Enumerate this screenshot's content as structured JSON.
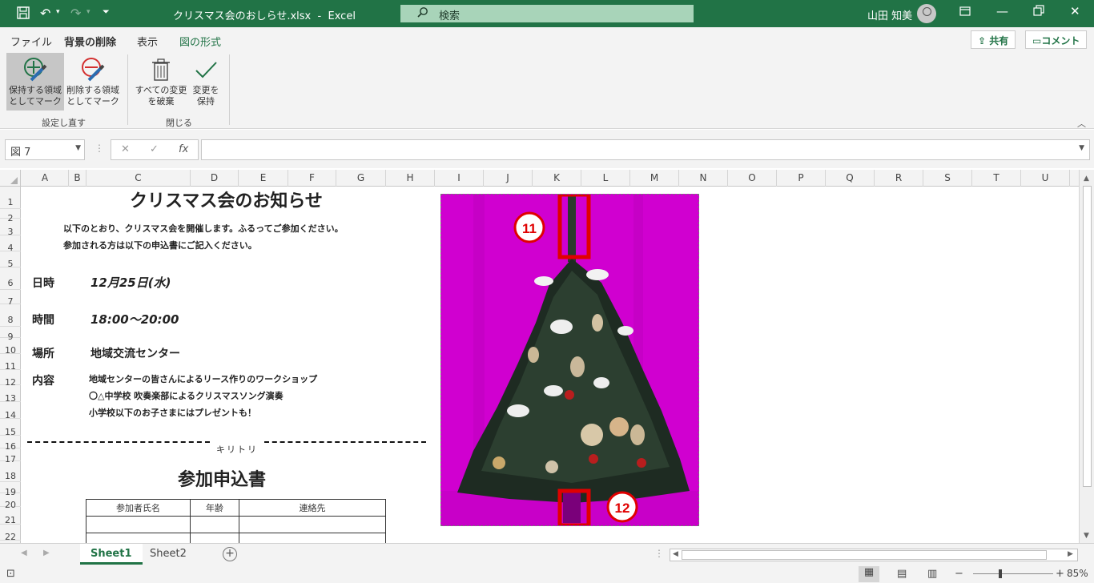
{
  "window": {
    "filename": "クリスマス会のおしらせ.xlsx",
    "separator": "-",
    "app": "Excel",
    "search_placeholder": "検索",
    "user_name": "山田 知美"
  },
  "ribbon": {
    "tabs": [
      "ファイル",
      "背景の削除",
      "表示",
      "図の形式"
    ],
    "share_label": "共有",
    "comment_label": "コメント",
    "buttons": {
      "mark_keep_l1": "保持する領域",
      "mark_keep_l2": "としてマーク",
      "mark_remove_l1": "削除する領域",
      "mark_remove_l2": "としてマーク",
      "discard_l1": "すべての変更",
      "discard_l2": "を破棄",
      "keep_l1": "変更を",
      "keep_l2": "保持"
    },
    "groups": {
      "refine": "設定し直す",
      "close": "閉じる"
    }
  },
  "formula_bar": {
    "name_box": "図 7",
    "fx": "fx",
    "value": ""
  },
  "columns": [
    "A",
    "B",
    "C",
    "D",
    "E",
    "F",
    "G",
    "H",
    "I",
    "J",
    "K",
    "L",
    "M",
    "N",
    "O",
    "P",
    "Q",
    "R",
    "S",
    "T",
    "U"
  ],
  "rows": [
    "1",
    "2",
    "3",
    "4",
    "5",
    "6",
    "7",
    "8",
    "9",
    "10",
    "11",
    "12",
    "13",
    "14",
    "15",
    "16",
    "17",
    "18",
    "19",
    "20",
    "21",
    "22"
  ],
  "document": {
    "title": "クリスマス会のお知らせ",
    "intro_1": "以下のとおり、クリスマス会を開催します。ふるってご参加ください。",
    "intro_2": "参加される方は以下の申込書にご記入ください。",
    "date_label": "日時",
    "date_value": "12月25日(水)",
    "time_label": "時間",
    "time_value": "18:00～20:00",
    "place_label": "場所",
    "place_value": "地域交流センター",
    "content_label": "内容",
    "content_1": "地域センターの皆さんによるリース作りのワークショップ",
    "content_2": "〇△中学校 吹奏楽部によるクリスマスソング演奏",
    "content_3": "小学校以下のお子さまにはプレゼントも！",
    "cut_label": "キリトリ",
    "form_title": "参加申込書",
    "table_headers": [
      "参加者氏名",
      "年齢",
      "連絡先"
    ]
  },
  "picture": {
    "marker_11": "11",
    "marker_12": "12"
  },
  "sheets": [
    "Sheet1",
    "Sheet2"
  ],
  "status": {
    "zoom": "85%"
  },
  "colors": {
    "excel_green": "#217346",
    "bg_removal_magenta": "#d000d0",
    "highlight_red": "#e00000"
  }
}
